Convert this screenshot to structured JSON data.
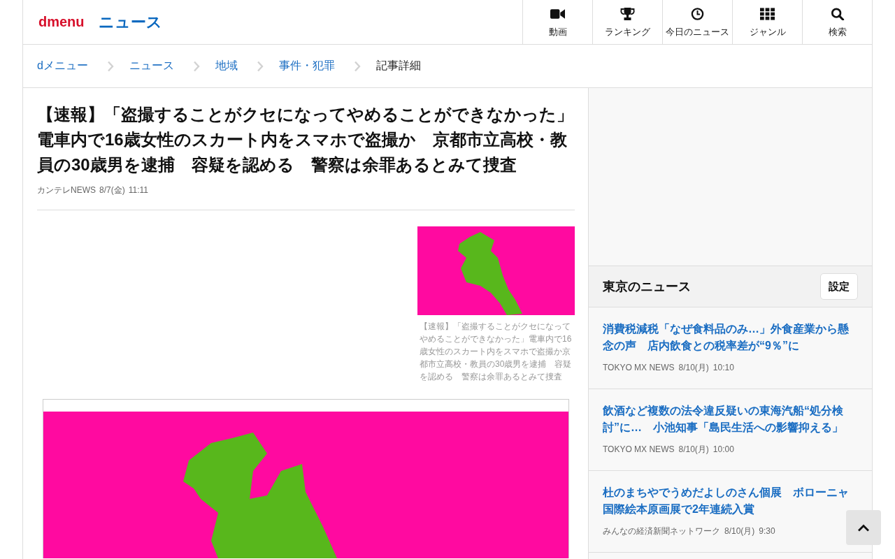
{
  "header": {
    "logo": "dmenu",
    "section": "ニュース",
    "nav": [
      {
        "label": "動画"
      },
      {
        "label": "ランキング"
      },
      {
        "label": "今日のニュース"
      },
      {
        "label": "ジャンル"
      },
      {
        "label": "検索"
      }
    ]
  },
  "breadcrumb": [
    {
      "label": "dメニュー",
      "current": false
    },
    {
      "label": "ニュース",
      "current": false
    },
    {
      "label": "地域",
      "current": false
    },
    {
      "label": "事件・犯罪",
      "current": false
    },
    {
      "label": "記事詳細",
      "current": true
    }
  ],
  "article": {
    "title": "【速報】「盗撮することがクセになってやめることができなかった」電車内で16歳女性のスカート内をスマホで盗撮か　京都市立高校・教員の30歳男を逮捕　容疑を認める　警察は余罪あるとみて捜査",
    "source": "カンテレNEWS",
    "date": "8/7(金)",
    "time": "11:11",
    "thumbnail_caption": "【速報】「盗撮することがクセになってやめることができなかった」電車内で16歳女性のスカート内をスマホで盗撮か京都市立高校・教員の30歳男を逮捕　容疑を認める　警察は余罪あるとみて捜査"
  },
  "sidebar": {
    "heading": "東京のニュース",
    "settings_button": "設定",
    "items": [
      {
        "title": "消費税減税「なぜ食料品のみ…」外食産業から懸念の声　店内飲食との税率差が“9％”に",
        "source": "TOKYO MX NEWS",
        "date": "8/10(月)",
        "time": "10:10"
      },
      {
        "title": "飲酒など複数の法令違反疑いの東海汽船“処分検討”に…　小池知事「島民生活への影響抑える」",
        "source": "TOKYO MX NEWS",
        "date": "8/10(月)",
        "time": "10:00"
      },
      {
        "title": "杜のまちやでうめだよしのさん個展　ボローニャ国際絵本原画展で2年連続入賞",
        "source": "みんなの経済新聞ネットワーク",
        "date": "8/10(月)",
        "time": "9:30"
      }
    ]
  }
}
